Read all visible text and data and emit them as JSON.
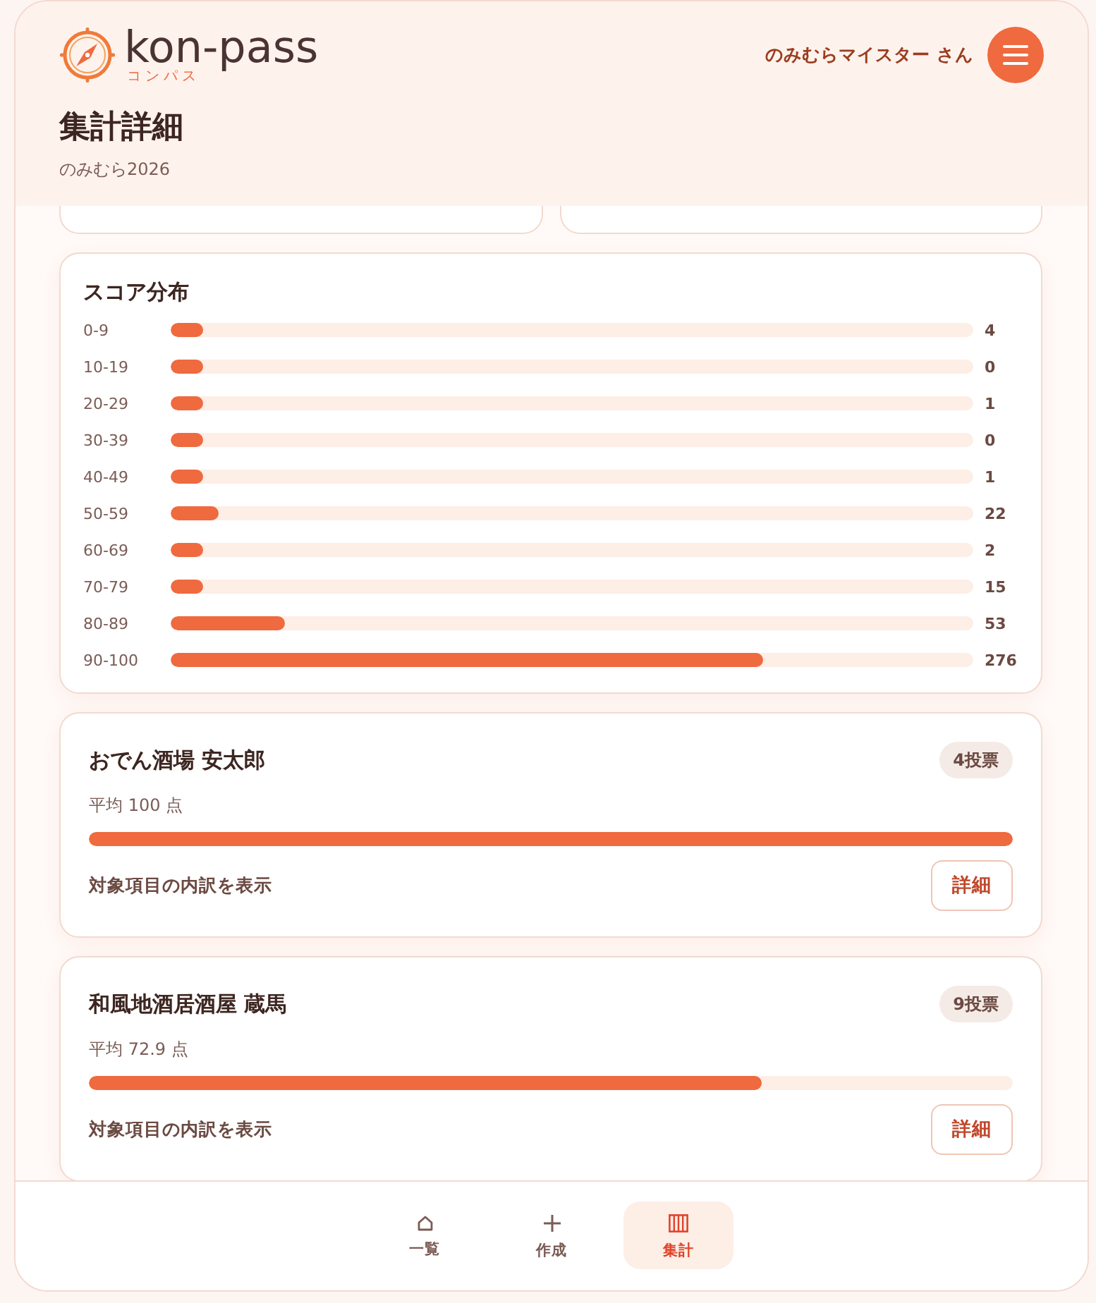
{
  "header": {
    "logo": {
      "wordmark": "kon-pass",
      "reading": "コンパス"
    },
    "user_name": "のみむらマイスター さん",
    "title": "集計詳細",
    "subtitle": "のみむら2026"
  },
  "score_distribution": {
    "title": "スコア分布",
    "rows": [
      {
        "range": "0-9",
        "level": 0.011,
        "count": "4"
      },
      {
        "range": "10-19",
        "level": 0,
        "count": "0"
      },
      {
        "range": "20-29",
        "level": 0.003,
        "count": "1"
      },
      {
        "range": "30-39",
        "level": 0,
        "count": "0"
      },
      {
        "range": "40-49",
        "level": 0.003,
        "count": "1"
      },
      {
        "range": "50-59",
        "level": 0.059,
        "count": "22"
      },
      {
        "range": "60-69",
        "level": 0.005,
        "count": "2"
      },
      {
        "range": "70-79",
        "level": 0.04,
        "count": "15"
      },
      {
        "range": "80-89",
        "level": 0.142,
        "count": "53"
      },
      {
        "range": "90-100",
        "level": 0.738,
        "count": "276"
      }
    ]
  },
  "stores": [
    {
      "name": "おでん酒場 安太郎",
      "votes": "4投票",
      "average": "平均 100 点",
      "level": 1,
      "breakdown_label": "対象項目の内訳を表示",
      "button": "詳細"
    },
    {
      "name": "和風地酒居酒屋 蔵馬",
      "votes": "9投票",
      "average": "平均 72.9 点",
      "level": 0.729,
      "breakdown_label": "対象項目の内訳を表示",
      "button": "詳細"
    }
  ],
  "bottom_nav": [
    {
      "label": "一覧",
      "selected": false
    },
    {
      "label": "作成",
      "selected": false
    },
    {
      "label": "集計",
      "selected": true
    }
  ]
}
